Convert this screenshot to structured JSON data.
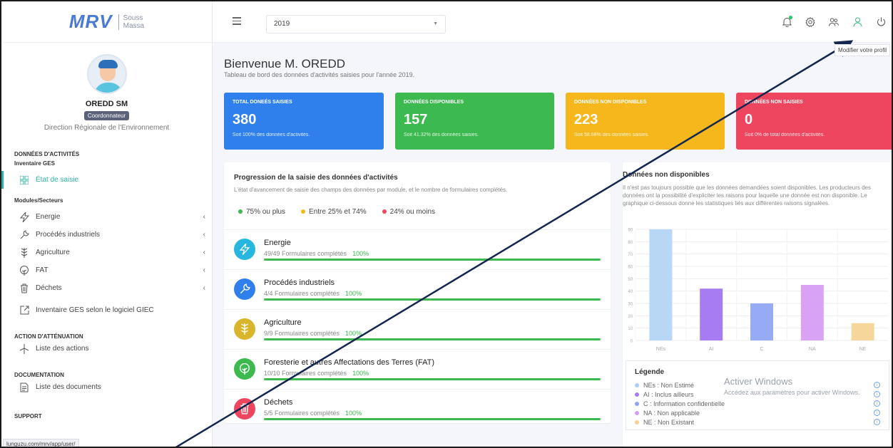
{
  "sidebar": {
    "brand": {
      "name": "MRV",
      "sub1": "Souss",
      "sub2": "Massa"
    },
    "profile": {
      "name": "OREDD SM",
      "role": "Coordonnateur",
      "org": "Direction Régionale de l'Environnement"
    },
    "section_activities": "DONNÉES D'ACTIVITÉS",
    "sub_inventaire": "Inventaire GES",
    "item_etat": "État de saisie",
    "sub_modules": "Modules/Secteurs",
    "items": [
      "Energie",
      "Procédés industriels",
      "Agriculture",
      "FAT",
      "Déchets"
    ],
    "item_giec": "Inventaire GES selon le logiciel GIEC",
    "section_attenuation": "ACTION D'ATTÉNUATION",
    "item_actions": "Liste des actions",
    "section_documentation": "DOCUMENTATION",
    "item_documents": "Liste des documents",
    "section_support": "SUPPORT",
    "status_url": "lunguzu.com/mrv/app/user/"
  },
  "topbar": {
    "year": "2019",
    "tooltip": "Modifier votre profil"
  },
  "main": {
    "welcome": "Bienvenue M. OREDD",
    "welcome_sub": "Tableau de bord des données d'activités saisies pour l'année 2019.",
    "stats": [
      {
        "label": "TOTAL DONEÉS SAISIES",
        "value": "380",
        "sub": "Soit 100% des données d'activités."
      },
      {
        "label": "DONNÉES DISPONIBLES",
        "value": "157",
        "sub": "Soit 41.32% des données saisies."
      },
      {
        "label": "DONNÉES NON DISPONIBLES",
        "value": "223",
        "sub": "Soit 58.68% des données saisies."
      },
      {
        "label": "DONNÉES NON SAISIES",
        "value": "0",
        "sub": "Soit 0% de total données d'activités."
      }
    ],
    "progress": {
      "title": "Progression de la saisie des données d'activités",
      "desc": "L'état d'avancement de saisie des champs des données par module, et le nombre de formulaires complétés.",
      "legend": [
        "75% ou plus",
        "Entre 25% et 74%",
        "24% ou moins"
      ],
      "legend_colors": [
        "#3cb94f",
        "#f5b71b",
        "#ef4660"
      ],
      "modules": [
        {
          "name": "Energie",
          "forms": "49/49 Formulaires complétés",
          "pct": "100%",
          "fill": 1.0,
          "color": "#26b6e0"
        },
        {
          "name": "Procédés industriels",
          "forms": "4/4 Formulaires complétés",
          "pct": "100%",
          "fill": 1.0,
          "color": "#2f80ed"
        },
        {
          "name": "Agriculture",
          "forms": "9/9 Formulaires complétés",
          "pct": "100%",
          "fill": 1.0,
          "color": "#d9b52b"
        },
        {
          "name": "Foresterie et autres Affectations des Terres (FAT)",
          "forms": "10/10 Formulaires complétés",
          "pct": "100%",
          "fill": 1.0,
          "color": "#3cb94f"
        },
        {
          "name": "Déchets",
          "forms": "5/5 Formulaires complétés",
          "pct": "100%",
          "fill": 1.0,
          "color": "#ef4660"
        }
      ]
    },
    "unavailable": {
      "title": "Données non disponibles",
      "desc": "Il n'est pas toujours possible que les données demandées soient disponibles. Les producteurs des données ont la possibilité d'expliciter les raisons pour laquelle une donnée est non disponible. Le graphique ci-dessous donne les statistiques liés aux différentes raisons signalées.",
      "legend_title": "Légende",
      "legend": [
        {
          "label": "NEs : Non Estimé",
          "color": "#a9cdf3"
        },
        {
          "label": "AI : Inclus ailleurs",
          "color": "#a77bf2"
        },
        {
          "label": "C : Information confidentielle",
          "color": "#8fa6f2"
        },
        {
          "label": "NA : Non applicable",
          "color": "#d69bf2"
        },
        {
          "label": "NE : Non Existant",
          "color": "#f7cf8f"
        }
      ],
      "watermark": "Activer Windows",
      "watermark_sub": "Accédez aux paramètres pour activer Windows."
    }
  },
  "chart_data": {
    "type": "bar",
    "categories": [
      "NEs",
      "AI",
      "C",
      "NA",
      "NE"
    ],
    "values": [
      90,
      42,
      30,
      45,
      14
    ],
    "colors": [
      "#b8d6f5",
      "#a77bf2",
      "#97aaf4",
      "#d9a3f5",
      "#f7d69c"
    ],
    "ylim": [
      0,
      90
    ],
    "yticks": [
      0,
      10,
      20,
      30,
      40,
      50,
      60,
      70,
      80,
      90
    ],
    "grid": true
  }
}
